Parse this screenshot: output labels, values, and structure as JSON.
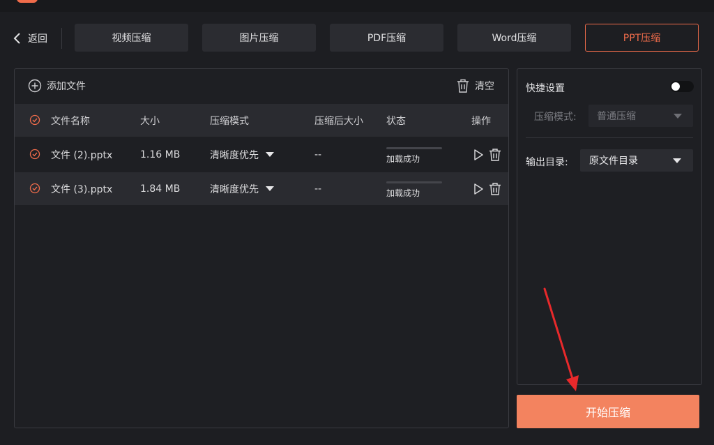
{
  "nav": {
    "back_label": "返回",
    "tabs": [
      {
        "label": "视频压缩",
        "active": false
      },
      {
        "label": "图片压缩",
        "active": false
      },
      {
        "label": "PDF压缩",
        "active": false
      },
      {
        "label": "Word压缩",
        "active": false
      },
      {
        "label": "PPT压缩",
        "active": true
      }
    ]
  },
  "file_panel": {
    "add_file_label": "添加文件",
    "clear_label": "清空",
    "columns": [
      "文件名称",
      "大小",
      "压缩模式",
      "压缩后大小",
      "状态",
      "操作"
    ],
    "rows": [
      {
        "name": "文件 (2).pptx",
        "size": "1.16 MB",
        "mode": "清晰度优先",
        "compressed_size": "--",
        "status": "加载成功"
      },
      {
        "name": "文件 (3).pptx",
        "size": "1.84 MB",
        "mode": "清晰度优先",
        "compressed_size": "--",
        "status": "加载成功"
      }
    ]
  },
  "settings": {
    "quick_settings_label": "快捷设置",
    "quick_settings_on": false,
    "compress_mode_label": "压缩模式:",
    "compress_mode_value": "普通压缩",
    "output_dir_label": "输出目录:",
    "output_dir_value": "原文件目录"
  },
  "start_button_label": "开始压缩",
  "colors": {
    "accent": "#f06c4b",
    "start_button": "#f3835f",
    "background": "#1d1e22",
    "panel": "#1e1f23",
    "tab_bg": "#2b2c31",
    "annotation_arrow": "#e8292b"
  }
}
